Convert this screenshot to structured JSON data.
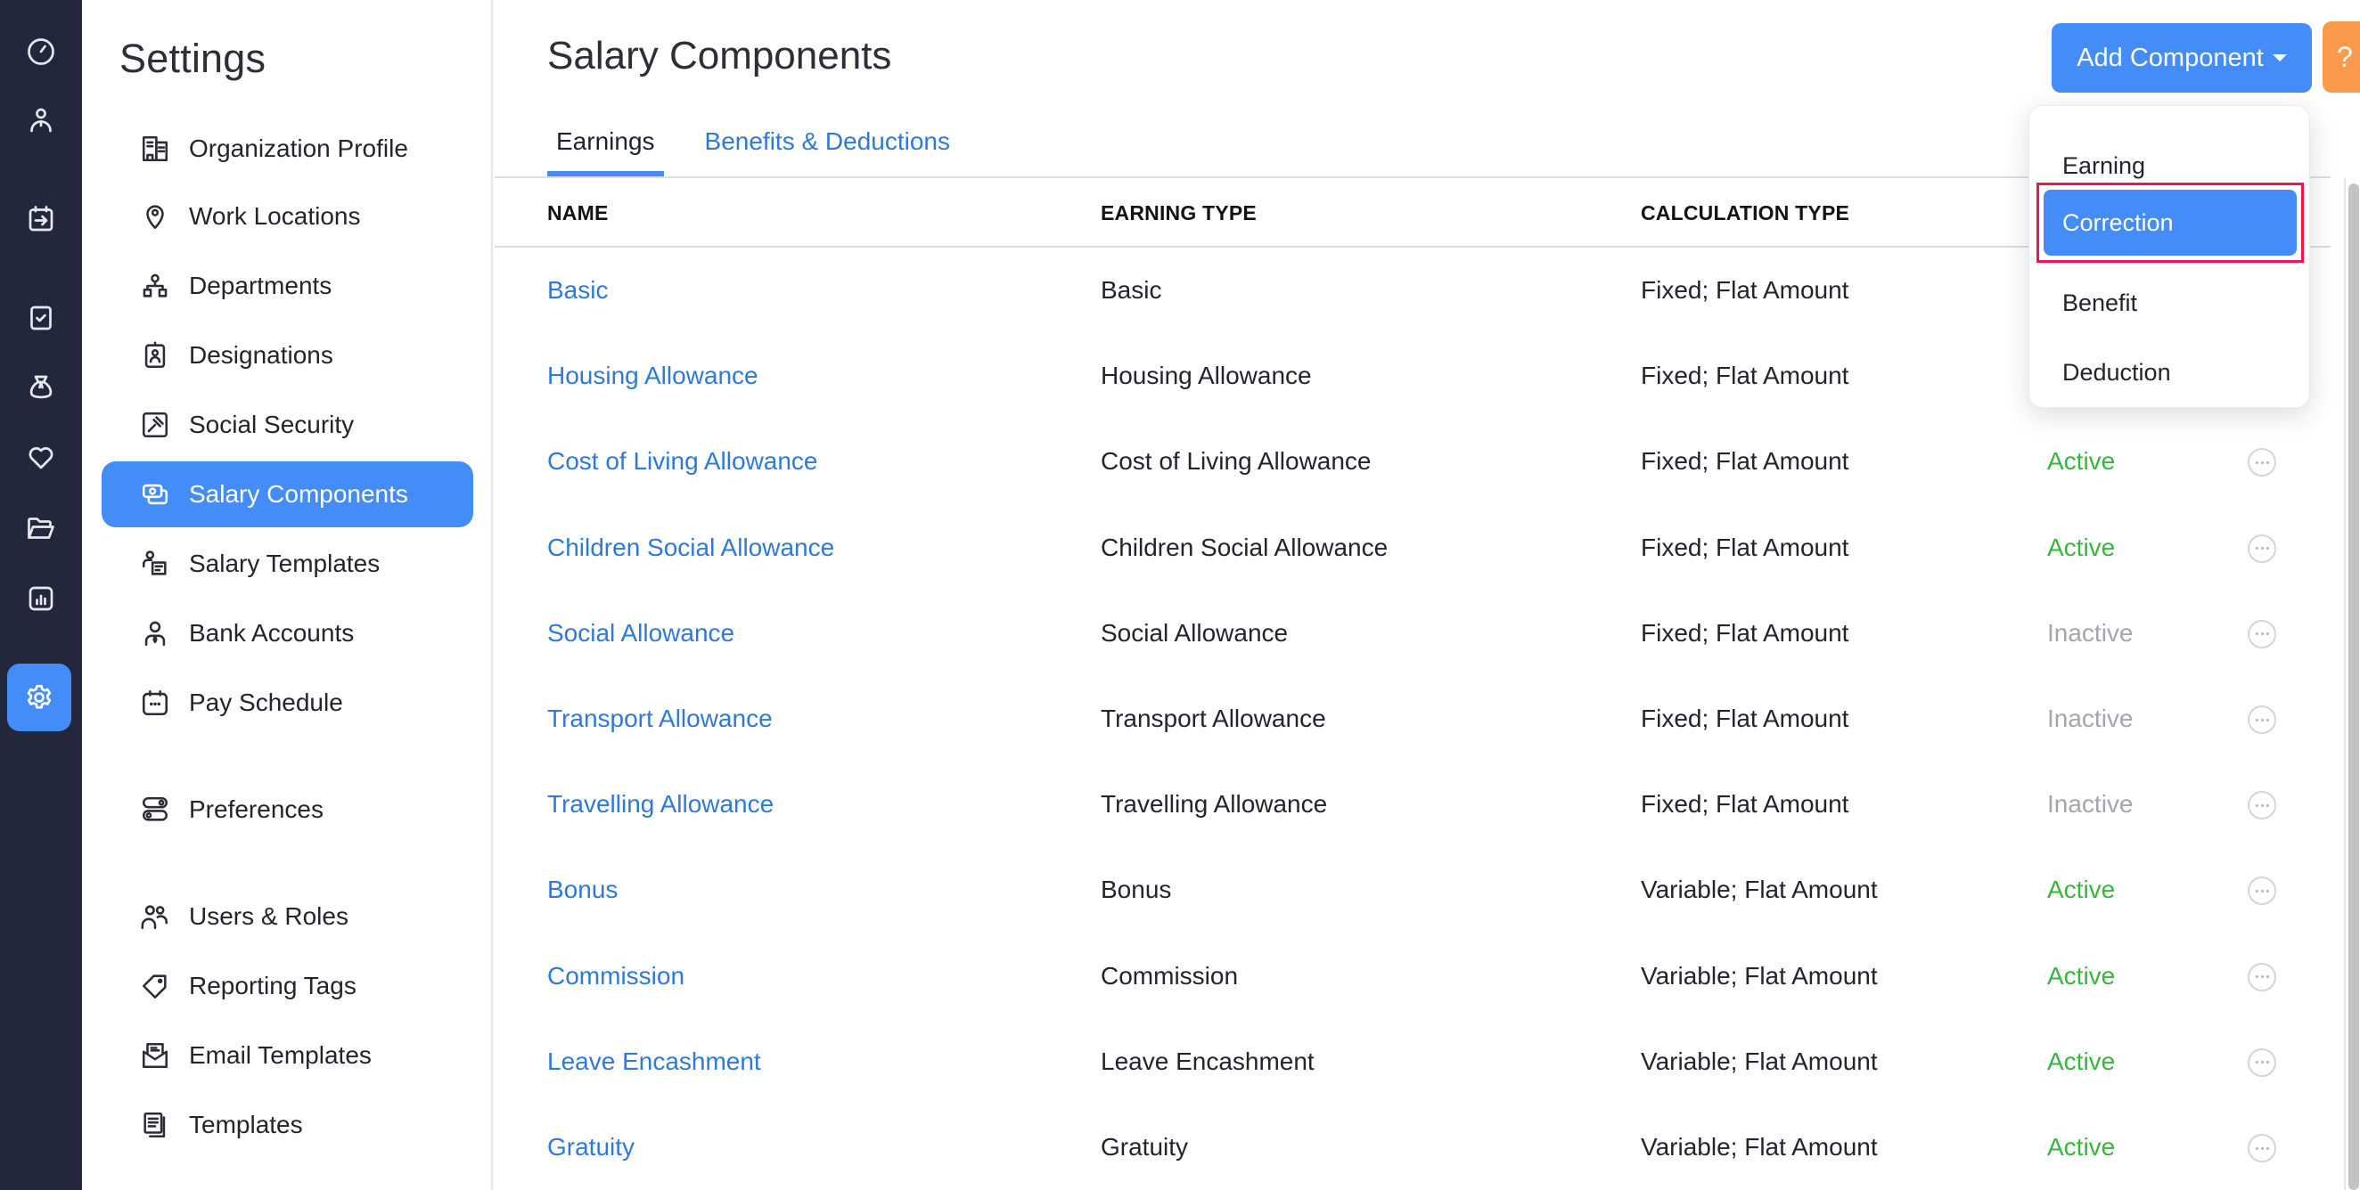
{
  "rail": {
    "items": [
      {
        "icon": "dashboard-gauge-icon",
        "active": false
      },
      {
        "icon": "employee-person-icon",
        "active": false
      },
      {
        "icon": "pay-run-calendar-arrow-icon",
        "active": false
      },
      {
        "icon": "approvals-checkbox-icon",
        "active": false
      },
      {
        "icon": "loans-money-bag-icon",
        "active": false
      },
      {
        "icon": "benefits-heart-icon",
        "active": false
      },
      {
        "icon": "documents-folder-icon",
        "active": false
      },
      {
        "icon": "reports-bar-chart-icon",
        "active": false
      },
      {
        "icon": "settings-gear-icon",
        "active": true
      }
    ]
  },
  "settings": {
    "title": "Settings",
    "items": [
      {
        "label": "Organization Profile",
        "icon": "building-icon"
      },
      {
        "label": "Work Locations",
        "icon": "location-pin-icon"
      },
      {
        "label": "Departments",
        "icon": "org-chart-icon"
      },
      {
        "label": "Designations",
        "icon": "id-badge-icon"
      },
      {
        "label": "Social Security",
        "icon": "gavel-icon"
      },
      {
        "label": "Salary Components",
        "icon": "money-cards-icon",
        "active": true
      },
      {
        "label": "Salary Templates",
        "icon": "person-template-icon"
      },
      {
        "label": "Bank Accounts",
        "icon": "person-tie-icon"
      },
      {
        "label": "Pay Schedule",
        "icon": "calendar-dots-icon"
      },
      {
        "label": "Preferences",
        "icon": "toggles-icon"
      },
      {
        "label": "Users & Roles",
        "icon": "users-icon"
      },
      {
        "label": "Reporting Tags",
        "icon": "tag-icon"
      },
      {
        "label": "Email Templates",
        "icon": "open-envelope-icon"
      },
      {
        "label": "Templates",
        "icon": "documents-stack-icon"
      }
    ]
  },
  "main": {
    "title": "Salary Components",
    "tabs": [
      {
        "label": "Earnings",
        "active": true
      },
      {
        "label": "Benefits & Deductions",
        "active": false
      }
    ],
    "add_button": "Add Component",
    "help_button": "?",
    "columns": [
      "NAME",
      "EARNING TYPE",
      "CALCULATION TYPE"
    ],
    "rows": [
      {
        "name": "Basic",
        "earning_type": "Basic",
        "calculation_type": "Fixed; Flat Amount",
        "status": ""
      },
      {
        "name": "Housing Allowance",
        "earning_type": "Housing Allowance",
        "calculation_type": "Fixed; Flat Amount",
        "status": ""
      },
      {
        "name": "Cost of Living Allowance",
        "earning_type": "Cost of Living Allowance",
        "calculation_type": "Fixed; Flat Amount",
        "status": "Active"
      },
      {
        "name": "Children Social Allowance",
        "earning_type": "Children Social Allowance",
        "calculation_type": "Fixed; Flat Amount",
        "status": "Active"
      },
      {
        "name": "Social Allowance",
        "earning_type": "Social Allowance",
        "calculation_type": "Fixed; Flat Amount",
        "status": "Inactive"
      },
      {
        "name": "Transport Allowance",
        "earning_type": "Transport Allowance",
        "calculation_type": "Fixed; Flat Amount",
        "status": "Inactive"
      },
      {
        "name": "Travelling Allowance",
        "earning_type": "Travelling Allowance",
        "calculation_type": "Fixed; Flat Amount",
        "status": "Inactive"
      },
      {
        "name": "Bonus",
        "earning_type": "Bonus",
        "calculation_type": "Variable; Flat Amount",
        "status": "Active"
      },
      {
        "name": "Commission",
        "earning_type": "Commission",
        "calculation_type": "Variable; Flat Amount",
        "status": "Active"
      },
      {
        "name": "Leave Encashment",
        "earning_type": "Leave Encashment",
        "calculation_type": "Variable; Flat Amount",
        "status": "Active"
      },
      {
        "name": "Gratuity",
        "earning_type": "Gratuity",
        "calculation_type": "Variable; Flat Amount",
        "status": "Active"
      }
    ]
  },
  "dropdown": {
    "items": [
      {
        "label": "Earning",
        "highlighted": false
      },
      {
        "label": "Correction",
        "highlighted": true
      },
      {
        "label": "Benefit",
        "highlighted": false
      },
      {
        "label": "Deduction",
        "highlighted": false
      }
    ]
  },
  "colors": {
    "accent": "#448cf7",
    "link": "#2f79d8",
    "rail_bg": "#22273b",
    "help": "#fb9a4a",
    "active_status": "#36b63b",
    "inactive_status": "#a4a6ad",
    "highlight_outline": "#f0144e"
  }
}
